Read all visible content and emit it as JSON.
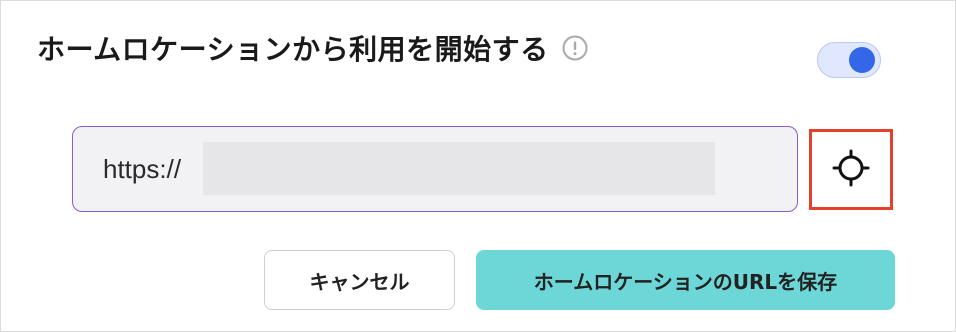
{
  "header": {
    "title": "ホームロケーションから利用を開始する",
    "info_icon": "info-circle-icon"
  },
  "toggle": {
    "state": "on",
    "accent_color": "#3467e8"
  },
  "url_input": {
    "value": "https://",
    "redacted": true
  },
  "locate_button": {
    "icon": "crosshair-icon",
    "highlight_color": "#e2412b"
  },
  "actions": {
    "cancel_label": "キャンセル",
    "save_label": "ホームロケーションのURLを保存",
    "save_color": "#6dd6d6"
  }
}
